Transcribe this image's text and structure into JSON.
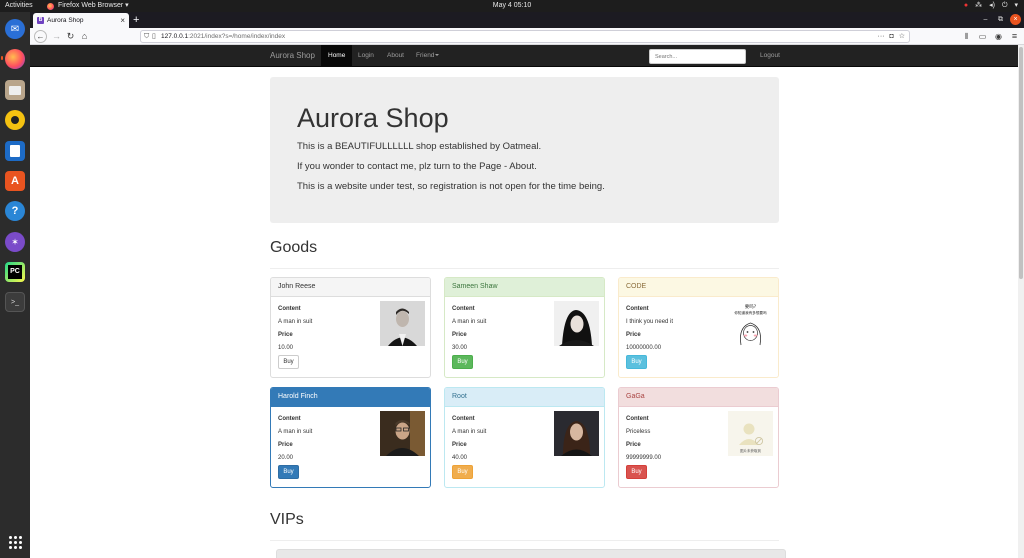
{
  "system": {
    "activities": "Activities",
    "app_menu": "Firefox Web Browser ▾",
    "clock": "May 4  05:10"
  },
  "browser": {
    "tab_title": "Aurora Shop",
    "url_host": "127.0.0.1",
    "url_rest": ":2021/index?s=/home/index/index"
  },
  "site": {
    "brand": "Aurora Shop",
    "nav": [
      "Home",
      "Login",
      "About",
      "Friend"
    ],
    "search_placeholder": "Search...",
    "logout": "Logout"
  },
  "jumbotron": {
    "title": "Aurora Shop",
    "lines": [
      "This is a BEAUTIFULLLLLL shop established by Oatmeal.",
      "If you wonder to contact me, plz turn to the Page - About.",
      "This is a website under test, so registration is not open for the time being."
    ]
  },
  "goods": {
    "title": "Goods",
    "content_label": "Content",
    "price_label": "Price",
    "buy_label": "Buy",
    "items": [
      {
        "name": "John Reese",
        "content": "A man in suit",
        "price": "10.00",
        "style": "default"
      },
      {
        "name": "Sameen Shaw",
        "content": "A man in suit",
        "price": "30.00",
        "style": "success"
      },
      {
        "name": "CODE",
        "content": "I think you need it",
        "price": "10000000.00",
        "style": "warning",
        "image_text_1": "要吗?",
        "image_text_2": "你知道我有多想要吗"
      },
      {
        "name": "Harold Finch",
        "content": "A man in suit",
        "price": "20.00",
        "style": "primary"
      },
      {
        "name": "Root",
        "content": "A man in suit",
        "price": "40.00",
        "style": "info"
      },
      {
        "name": "GaGa",
        "content": "Priceless",
        "price": "99999999.00",
        "style": "danger",
        "image_text_1": "图片未获取到"
      }
    ]
  },
  "vips": {
    "title": "VIPs"
  }
}
